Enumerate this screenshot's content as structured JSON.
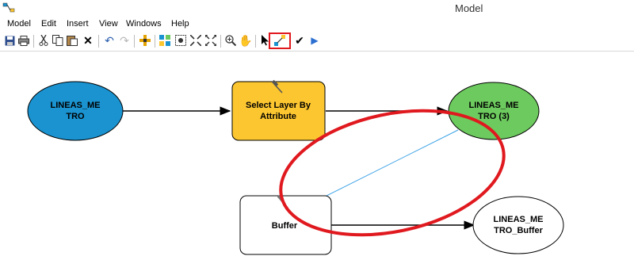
{
  "window": {
    "title": "Model"
  },
  "menu": {
    "items": [
      "Model",
      "Edit",
      "Insert",
      "View",
      "Windows",
      "Help"
    ]
  },
  "toolbar": {
    "icons": [
      "save-icon",
      "print-icon",
      "cut-icon",
      "copy-icon",
      "paste-icon",
      "delete-icon",
      "undo-icon",
      "redo-icon",
      "add-data-icon",
      "auto-layout-icon",
      "full-extent-icon",
      "zoom-in-fixed-icon",
      "zoom-out-fixed-icon",
      "zoom-in-icon",
      "pan-icon",
      "select-icon",
      "connect-icon",
      "validate-icon",
      "run-icon"
    ],
    "highlighted": "connect-icon",
    "highlight_color": "#e0191f"
  },
  "model": {
    "nodes": {
      "input": {
        "line1": "LINEAS_ME",
        "line2": "TRO",
        "fill": "#1a93d0"
      },
      "tool1": {
        "line1": "Select Layer By",
        "line2": "Attribute",
        "fill": "#fcc630"
      },
      "output1": {
        "line1": "LINEAS_ME",
        "line2": "TRO (3)",
        "fill": "#6dca5e"
      },
      "tool2": {
        "line1": "Buffer",
        "fill": "#ffffff"
      },
      "output2": {
        "line1": "LINEAS_ME",
        "line2": "TRO_Buffer",
        "fill": "#ffffff"
      }
    },
    "annotation_color": "#e0191f",
    "connector_color": "#3ba2e6"
  }
}
